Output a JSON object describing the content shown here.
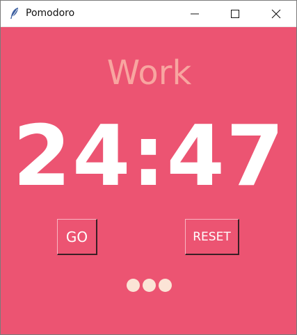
{
  "window": {
    "title": "Pomodoro"
  },
  "timer": {
    "label": "Work",
    "time": "24:47"
  },
  "buttons": {
    "go": "GO",
    "reset": "RESET"
  },
  "checkmarks": [
    "●",
    "●",
    "●"
  ],
  "colors": {
    "background": "#ec5472",
    "label": "#f8a5a0",
    "timer": "#ffffff",
    "checkmark": "#fbe4d6"
  },
  "icons": {
    "app": "feather-icon",
    "minimize": "minimize-icon",
    "maximize": "maximize-icon",
    "close": "close-icon"
  }
}
